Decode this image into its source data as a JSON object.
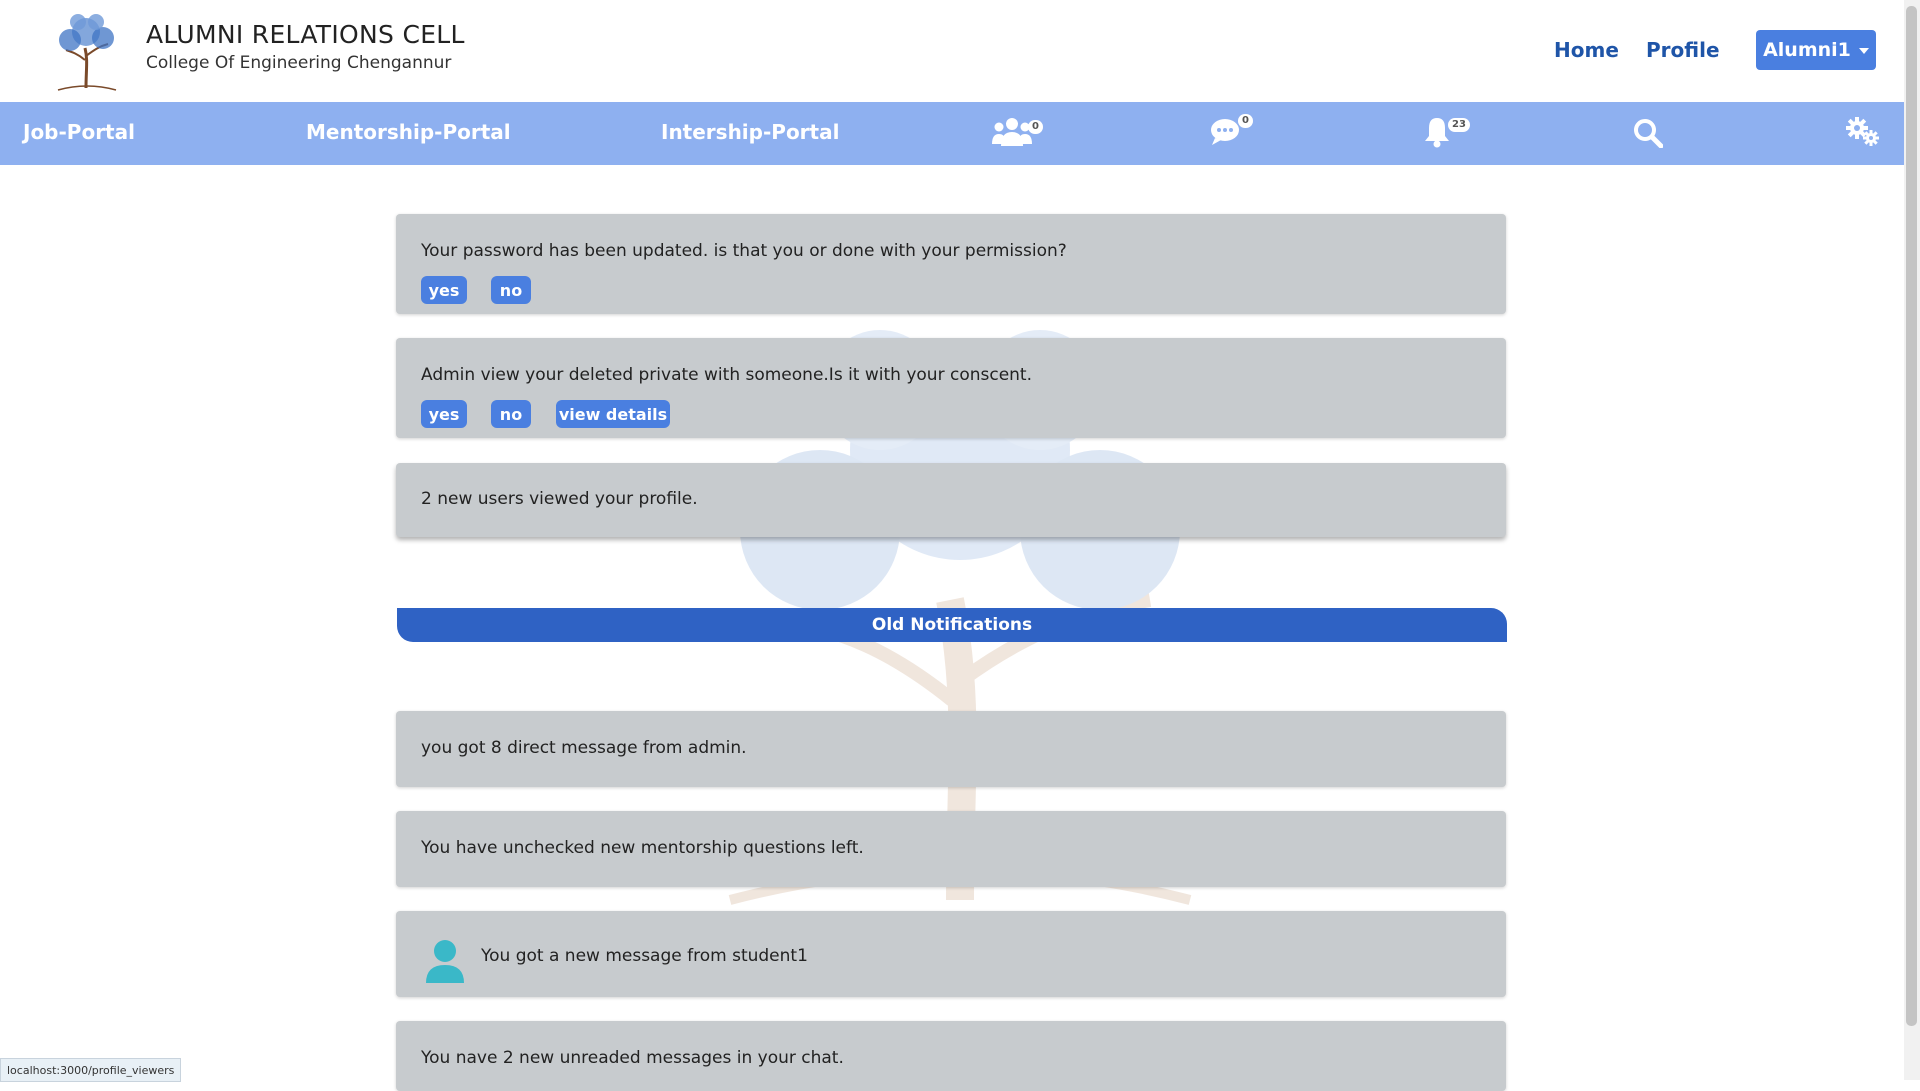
{
  "header": {
    "title": "ALUMNI RELATIONS CELL",
    "subtitle": "College Of Engineering Chengannur",
    "links": [
      "Home",
      "Profile"
    ],
    "user_menu": "Alumni1"
  },
  "nav": {
    "links": [
      "Job-Portal",
      "Mentorship-Portal",
      "Intership-Portal"
    ],
    "icons": [
      {
        "name": "users-icon",
        "badge": "0"
      },
      {
        "name": "chat-icon",
        "badge": "0"
      },
      {
        "name": "bell-icon",
        "badge": "23"
      },
      {
        "name": "search-icon"
      },
      {
        "name": "gears-icon"
      }
    ]
  },
  "new_notifications": [
    {
      "text": "Your password has been updated. is that you or done with your permission?",
      "actions": [
        "yes",
        "no"
      ]
    },
    {
      "text": "Admin view your deleted private with someone.Is it with your conscent.",
      "actions": [
        "yes",
        "no",
        "view details"
      ]
    },
    {
      "text": "2 new users viewed your profile."
    }
  ],
  "old_section_title": "Old Notifications",
  "old_notifications": [
    {
      "text": "you got 8 direct message from admin."
    },
    {
      "text": "You have unchecked new mentorship questions left."
    },
    {
      "text": "You got a new message from student1",
      "icon": "user-avatar-icon"
    },
    {
      "text": "You nave 2 new unreaded messages in your chat."
    }
  ],
  "status_url": "localhost:3000/profile_viewers",
  "colors": {
    "nav_bg": "#8eb0f0",
    "accent": "#4a7fe0",
    "section_bar": "#2f62c4",
    "card_bg": "#c7cbce",
    "link": "#1f55a8",
    "avatar": "#3ab8c8"
  }
}
